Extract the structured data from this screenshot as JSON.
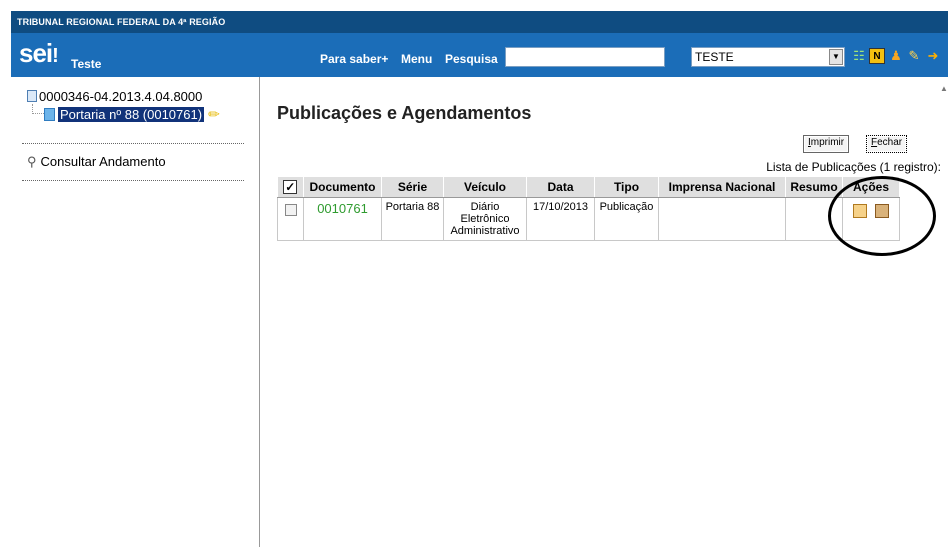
{
  "org_name": "TRIBUNAL REGIONAL FEDERAL DA 4ª REGIÃO",
  "header": {
    "logo": "sei",
    "logo_dot": "!",
    "unit_label": "Teste",
    "links": [
      "Para saber+",
      "Menu",
      "Pesquisa"
    ],
    "search_value": "",
    "unit_select_value": "TESTE",
    "icons": [
      "grid-icon",
      "note-icon",
      "user-icon",
      "tools-icon",
      "exit-icon"
    ]
  },
  "sidebar": {
    "process_number": "0000346-04.2013.4.04.8000",
    "document_label": "Portaria nº 88 (0010761)",
    "consult_label": "Consultar Andamento"
  },
  "main": {
    "title": "Publicações e Agendamentos",
    "print_button": {
      "label_u": "I",
      "label_rest": "mprimir"
    },
    "close_button": {
      "label_u": "F",
      "label_rest": "echar"
    },
    "list_caption": "Lista de Publicações (1 registro):",
    "table": {
      "headers": [
        "Documento",
        "Série",
        "Veículo",
        "Data",
        "Tipo",
        "Imprensa Nacional",
        "Resumo",
        "Ações"
      ],
      "rows": [
        {
          "documento": "0010761",
          "serie": "Portaria 88",
          "veiculo": "Diário Eletrônico Administrativo",
          "data": "17/10/2013",
          "tipo": "Publicação",
          "imprensa": "",
          "resumo": ""
        }
      ]
    }
  },
  "colors": {
    "topbar": "#0f4c81",
    "header": "#1b6db8",
    "link_green": "#2f9b2f",
    "selected_bg": "#11337a"
  }
}
